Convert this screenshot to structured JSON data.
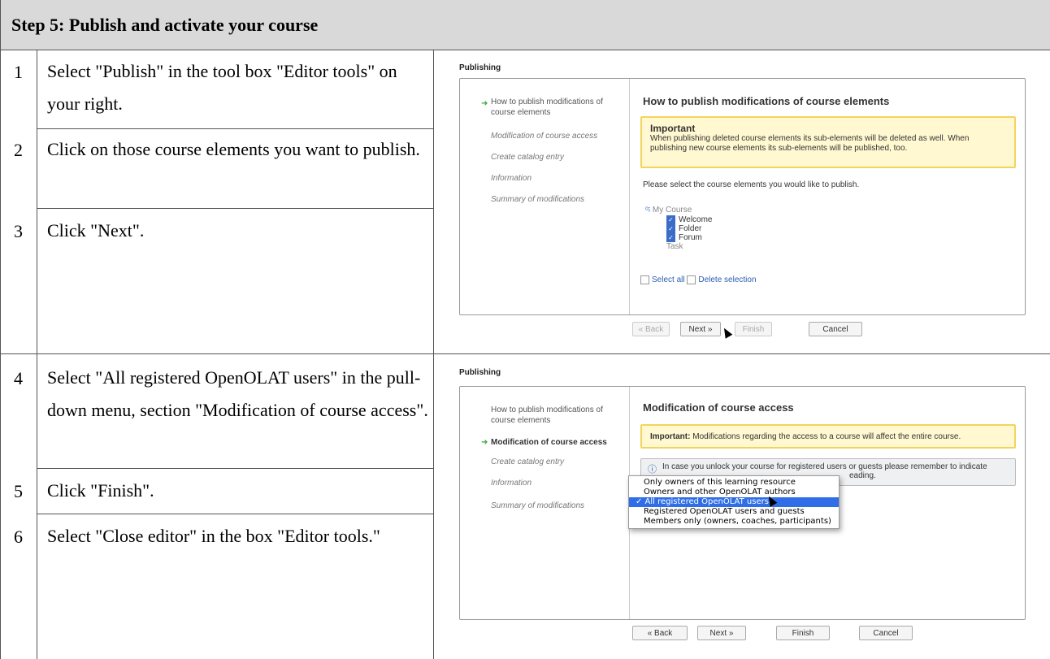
{
  "header": {
    "title": "Step 5: Publish and activate your course"
  },
  "steps": [
    {
      "num": "1",
      "text": "Select \"Publish\" in the tool box \"Editor tools\" on your right."
    },
    {
      "num": "2",
      "text": "Click on those course elements you want to publish."
    },
    {
      "num": "3",
      "text": "Click \"Next\"."
    },
    {
      "num": "4",
      "text": "Select \"All registered OpenOLAT users\" in the pull-down menu, section \"Modification of course access\"."
    },
    {
      "num": "5",
      "text": "Click \"Finish\"."
    },
    {
      "num": "6",
      "text": "Select \"Close editor\" in the box \"Editor tools.\""
    }
  ],
  "shot1": {
    "title": "Publishing",
    "nav": [
      "How to publish modifications of course elements",
      "Modification of course access",
      "Create catalog entry",
      "Information",
      "Summary of modifications"
    ],
    "heading": "How to publish modifications of course elements",
    "important_title": "Important",
    "important_text": "When publishing deleted course elements its sub-elements will be deleted as well. When publishing new course elements its sub-elements will be published, too.",
    "instruction": "Please select the course elements you would like to publish.",
    "tree": {
      "root": "My Course",
      "items": [
        "Welcome",
        "Folder",
        "Forum",
        "Task"
      ]
    },
    "select_all": "Select all",
    "delete_selection": "Delete selection",
    "buttons": {
      "back": "« Back",
      "next": "Next »",
      "finish": "Finish",
      "cancel": "Cancel"
    }
  },
  "shot2": {
    "title": "Publishing",
    "nav": [
      "How to publish modifications of course elements",
      "Modification of course access",
      "Create catalog entry",
      "Information",
      "Summary of modifications"
    ],
    "heading": "Modification of course access",
    "important_bold": "Important:",
    "important_text": "Modifications regarding the access to a course will affect the entire course.",
    "info_text": "In case you unlock your course for registered users or guests please remember to indicate",
    "info_tail": "eading.",
    "dropdown": [
      "Only owners of this learning resource",
      "Owners and other OpenOLAT authors",
      "✓ All registered OpenOLAT users",
      "Registered OpenOLAT users and guests",
      "Members only (owners, coaches, participants)"
    ],
    "buttons": {
      "back": "« Back",
      "next": "Next »",
      "finish": "Finish",
      "cancel": "Cancel"
    }
  }
}
